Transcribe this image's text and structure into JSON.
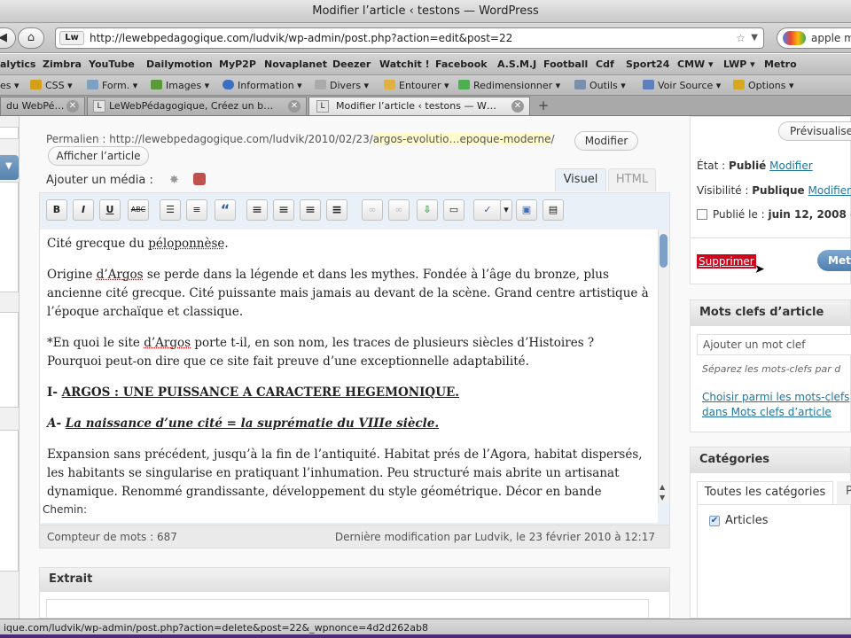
{
  "window": {
    "title": "Modifier l’article ‹ testons — WordPress"
  },
  "nav": {
    "url": "http://lewebpedagogique.com/ludvik/wp-admin/post.php?action=edit&post=22",
    "search_value": "apple m",
    "favicon_text": "Lw"
  },
  "bookmarks": [
    "alytics",
    "Zimbra",
    "YouTube",
    "Dailymotion",
    "MyP2P",
    "Novaplanet",
    "Deezer",
    "Watchit !",
    "Facebook",
    "A.S.M.J",
    "Football",
    "Cdf",
    "Sport24",
    "CMW ▾",
    "LWP ▾",
    "Metro"
  ],
  "toolbar2": [
    "es ▾",
    "CSS ▾",
    "Form. ▾",
    "Images ▾",
    "Information ▾",
    "Divers ▾",
    "Entourer ▾",
    "Redimensionner ▾",
    "Outils ▾",
    "Voir Source ▾",
    "Options ▾"
  ],
  "tabs": [
    "du WebPé…",
    "LeWebPédagogique, Créez un b…",
    "Modifier l’article ‹ testons — W…"
  ],
  "tab_add": "+",
  "permalink": {
    "label": "Permalien : http://lewebpedagogique.com/ludvik/2010/02/23/",
    "slug": "argos-evolutio…epoque-moderne",
    "slash": "/",
    "modify_button": "Modifier",
    "view_button": "Afficher l’article"
  },
  "media": {
    "label": "Ajouter un média :"
  },
  "editor_tabs": {
    "visual": "Visuel",
    "html": "HTML"
  },
  "editor_toolbar": [
    {
      "icon": "bold-icon",
      "glyph": "B"
    },
    {
      "icon": "italic-icon",
      "glyph": "I"
    },
    {
      "icon": "underline-icon",
      "glyph": "U"
    },
    {
      "icon": "strikethrough-icon",
      "glyph": "ABC"
    },
    {
      "icon": "bullet-list-icon",
      "glyph": "☰"
    },
    {
      "icon": "numbered-list-icon",
      "glyph": "≡"
    },
    {
      "icon": "blockquote-icon",
      "glyph": "“"
    },
    {
      "icon": "align-left-icon",
      "glyph": "≡"
    },
    {
      "icon": "align-center-icon",
      "glyph": "≡"
    },
    {
      "icon": "align-right-icon",
      "glyph": "≡"
    },
    {
      "icon": "align-justify-icon",
      "glyph": "≡"
    },
    {
      "icon": "link-icon",
      "glyph": "∞"
    },
    {
      "icon": "unlink-icon",
      "glyph": "∞"
    },
    {
      "icon": "insert-more-icon",
      "glyph": "⇩"
    },
    {
      "icon": "page-break-icon",
      "glyph": "▭"
    },
    {
      "icon": "spellcheck-icon",
      "glyph": "✓"
    },
    {
      "icon": "spellcheck-dropdown-icon",
      "glyph": "▾"
    },
    {
      "icon": "fullscreen-icon",
      "glyph": "▣"
    },
    {
      "icon": "kitchen-sink-icon",
      "glyph": "▤"
    }
  ],
  "content": {
    "p1_a": "Cité grecque du ",
    "p1_b": "péloponnèse",
    "p1_c": ".",
    "p2_a": "Origine ",
    "p2_b": "d’Argos",
    "p2_c": " se perde dans la légende et dans les mythes. Fondée à l’âge du bronze, plus ancienne cité grecque. Cité puissante mais jamais au devant de la scène. Grand centre artistique à l’époque archaïque et classique.",
    "p3_a": "*En quoi le site ",
    "p3_b": "d’Argos",
    "p3_c": " porte t-il, en son nom, les traces de plusieurs siècles d’Histoires ? Pourquoi peut-on dire que ce site fait preuve d’une exceptionnelle adaptabilité.",
    "h1_prefix": "I- ",
    "h1_text": "ARGOS : UNE PUISSANCE A CARACTERE HEGEMONIQUE.",
    "h2_prefix": "A- ",
    "h2_text": "La naissance d’une cité = la suprématie du VIIIe siècle.",
    "p4": "Expansion sans précédent, jusqu’à la fin de l’antiquité. Habitat prés de l’Agora, habitat dispersés, les habitants se singularise en pratiquant l’inhumation. Peu structuré mais abrite un artisanat dynamique. Renommé grandissante, développement du style géométrique. Décor en bande horizontale. Du IX à la fin"
  },
  "editor_footer": {
    "path_label": "Chemin:",
    "word_count": "Compteur de mots : 687",
    "last_modified": "Dernière modification par Ludvik, le 23 février 2010 à 12:17"
  },
  "excerpt": {
    "title": "Extrait"
  },
  "publish": {
    "preview_button": "Prévisualiser",
    "state_label": "État : ",
    "state_value": "Publié",
    "state_link": "Modifier",
    "visibility_label": "Visibilité : ",
    "visibility_value": "Publique",
    "visibility_link": "Modifier",
    "published_label": "Publié le : ",
    "published_value": "juin 12, 2008 @",
    "delete_link": "Supprimer",
    "update_button": "Mett"
  },
  "tags": {
    "title": "Mots clefs d’article",
    "input_placeholder": "Ajouter un mot clef",
    "hint": "Séparez les mots-clefs par d",
    "choose_link_1": "Choisir parmi les mots-clefs",
    "choose_link_2": "dans Mots clefs d’article"
  },
  "categories": {
    "title": "Catégories",
    "tab_all": "Toutes les catégories",
    "tab_popular": "P",
    "item": "Articles",
    "item_checked": true
  },
  "statusbar": {
    "text": "ique.com/ludvik/wp-admin/post.php?action=delete&post=22&_wpnonce=4d2d262ab8"
  },
  "colors": {
    "accent": "#21759b",
    "delete_red": "#d0021b",
    "scroll_blue": "#7da0c9"
  }
}
